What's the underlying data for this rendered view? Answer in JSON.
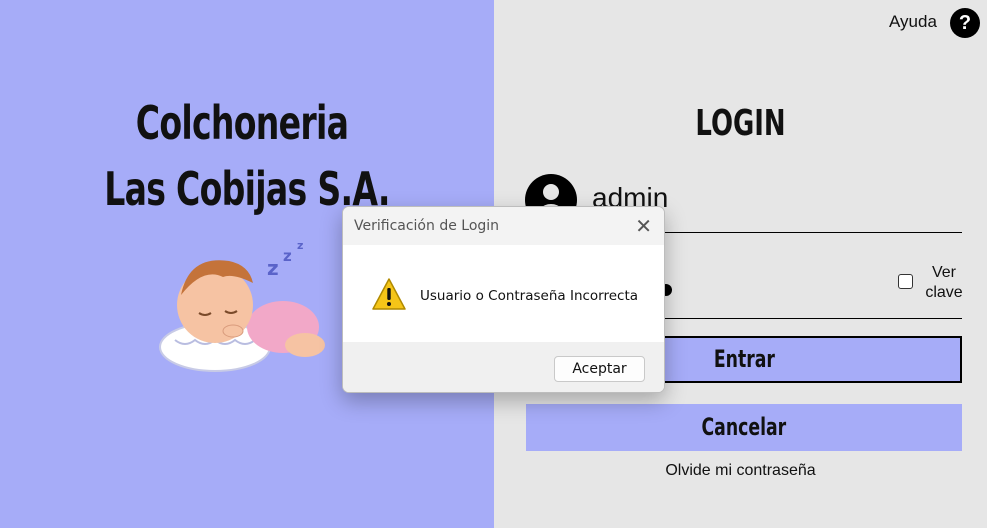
{
  "brand": {
    "line1": "Colchoneria",
    "line2": "Las Cobijas S.A."
  },
  "help": {
    "label": "Ayuda",
    "icon_glyph": "?"
  },
  "login": {
    "heading": "LOGIN",
    "username_value": "admin",
    "show_password_label_line1": "Ver",
    "show_password_label_line2": "clave",
    "enter_label": "Entrar",
    "cancel_label": "Cancelar",
    "forgot_label": "Olvide mi contraseña"
  },
  "dialog": {
    "title": "Verificación de Login",
    "close_glyph": "✕",
    "message": "Usuario o Contraseña Incorrecta",
    "ok_label": "Aceptar"
  },
  "colors": {
    "accent": "#a6acf8",
    "panel_bg": "#e6e6e6",
    "warning": "#f5c518"
  }
}
